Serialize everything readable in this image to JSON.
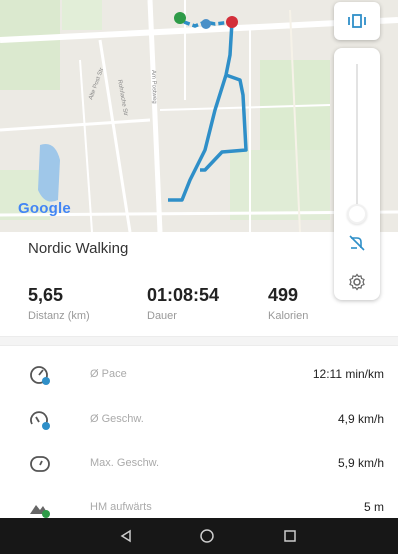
{
  "map": {
    "attribution": "Google",
    "route_color": "#2f8fc8",
    "start_color": "#2e9b48",
    "end_color": "#d32f3a",
    "road_labels": [
      "Rohrlache Str",
      "Am Postweg",
      "Alte Post Str"
    ]
  },
  "controls": {
    "layer_icon": "view-carousel-icon",
    "map_style_icon": "route-toggle-icon",
    "settings_icon": "gear-icon"
  },
  "activity": {
    "title": "Nordic Walking",
    "stats": [
      {
        "value": "5,65",
        "label": "Distanz (km)"
      },
      {
        "value": "01:08:54",
        "label": "Dauer"
      },
      {
        "value": "499",
        "label": "Kalorien"
      }
    ]
  },
  "details": [
    {
      "icon": "pace-gauge-icon",
      "label": "Ø Pace",
      "value": "12:11 min/km"
    },
    {
      "icon": "speed-gauge-icon",
      "label": "Ø Geschw.",
      "value": "4,9 km/h"
    },
    {
      "icon": "max-speed-gauge-icon",
      "label": "Max. Geschw.",
      "value": "5,9 km/h"
    },
    {
      "icon": "elevation-up-icon",
      "label": "HM aufwärts",
      "value": "5 m"
    }
  ],
  "navbar": {
    "back_icon": "back-triangle-icon",
    "home_icon": "home-circle-icon",
    "recents_icon": "recents-square-icon"
  }
}
